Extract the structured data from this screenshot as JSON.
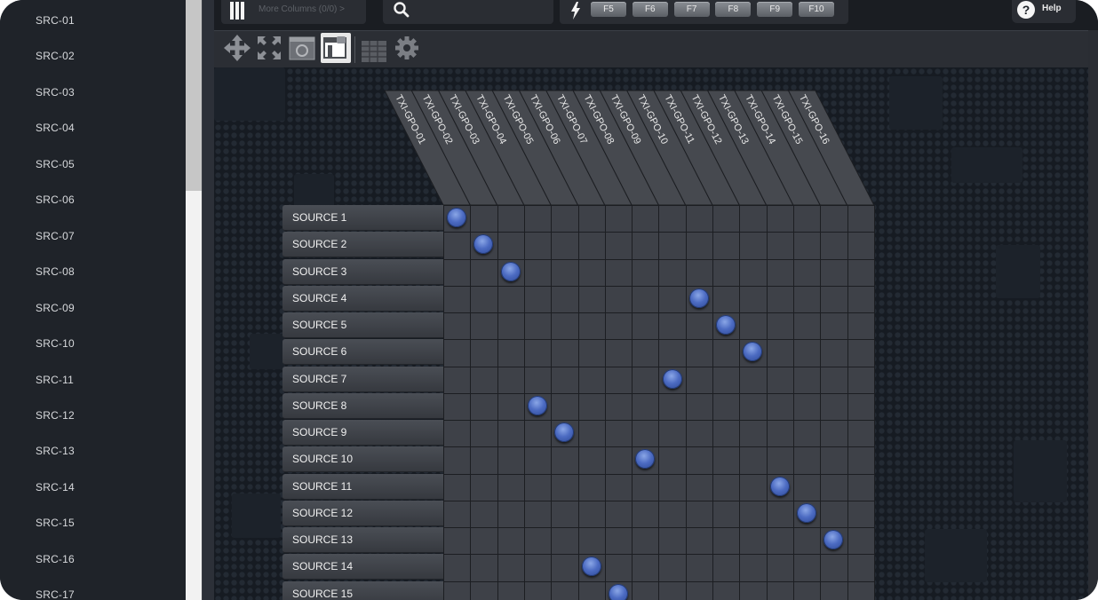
{
  "sidebar": {
    "items": [
      "SRC-01",
      "SRC-02",
      "SRC-03",
      "SRC-04",
      "SRC-05",
      "SRC-06",
      "SRC-07",
      "SRC-08",
      "SRC-09",
      "SRC-10",
      "SRC-11",
      "SRC-12",
      "SRC-13",
      "SRC-14",
      "SRC-15",
      "SRC-16",
      "SRC-17"
    ]
  },
  "toolbar": {
    "more_columns_label": "More Columns (0/0) >",
    "search_value": "",
    "function_keys": [
      "F5",
      "F6",
      "F7",
      "F8",
      "F9",
      "F10"
    ],
    "help_label": "Help"
  },
  "toolbar2": {
    "icons": [
      "move-icon",
      "expand-icon",
      "refresh-panel-icon",
      "lock-panel-icon",
      "grid-icon",
      "gear-icon"
    ]
  },
  "matrix": {
    "columns": [
      "TXI-GPO-01",
      "TXI-GPO-02",
      "TXI-GPO-03",
      "TXI-GPO-04",
      "TXI-GPO-05",
      "TXI-GPO-06",
      "TXI-GPO-07",
      "TXI-GPO-08",
      "TXI-GPO-09",
      "TXI-GPO-10",
      "TXI-GPO-11",
      "TXI-GPO-12",
      "TXI-GPO-13",
      "TXI-GPO-14",
      "TXI-GPO-15",
      "TXI-GPO-16"
    ],
    "rows": [
      "SOURCE 1",
      "SOURCE 2",
      "SOURCE 3",
      "SOURCE 4",
      "SOURCE 5",
      "SOURCE 6",
      "SOURCE 7",
      "SOURCE 8",
      "SOURCE 9",
      "SOURCE 10",
      "SOURCE 11",
      "SOURCE 12",
      "SOURCE 13",
      "SOURCE 14",
      "SOURCE 15"
    ],
    "crosspoints": [
      {
        "row": 1,
        "col": 1
      },
      {
        "row": 2,
        "col": 2
      },
      {
        "row": 3,
        "col": 3
      },
      {
        "row": 4,
        "col": 10
      },
      {
        "row": 5,
        "col": 11
      },
      {
        "row": 6,
        "col": 12
      },
      {
        "row": 7,
        "col": 9
      },
      {
        "row": 8,
        "col": 4
      },
      {
        "row": 9,
        "col": 5
      },
      {
        "row": 10,
        "col": 8
      },
      {
        "row": 11,
        "col": 13
      },
      {
        "row": 12,
        "col": 14
      },
      {
        "row": 13,
        "col": 15
      },
      {
        "row": 14,
        "col": 6
      },
      {
        "row": 15,
        "col": 7
      }
    ]
  },
  "colors": {
    "node": "#4c6bc2",
    "background": "#161b22",
    "sidebar": "#1f2329"
  }
}
